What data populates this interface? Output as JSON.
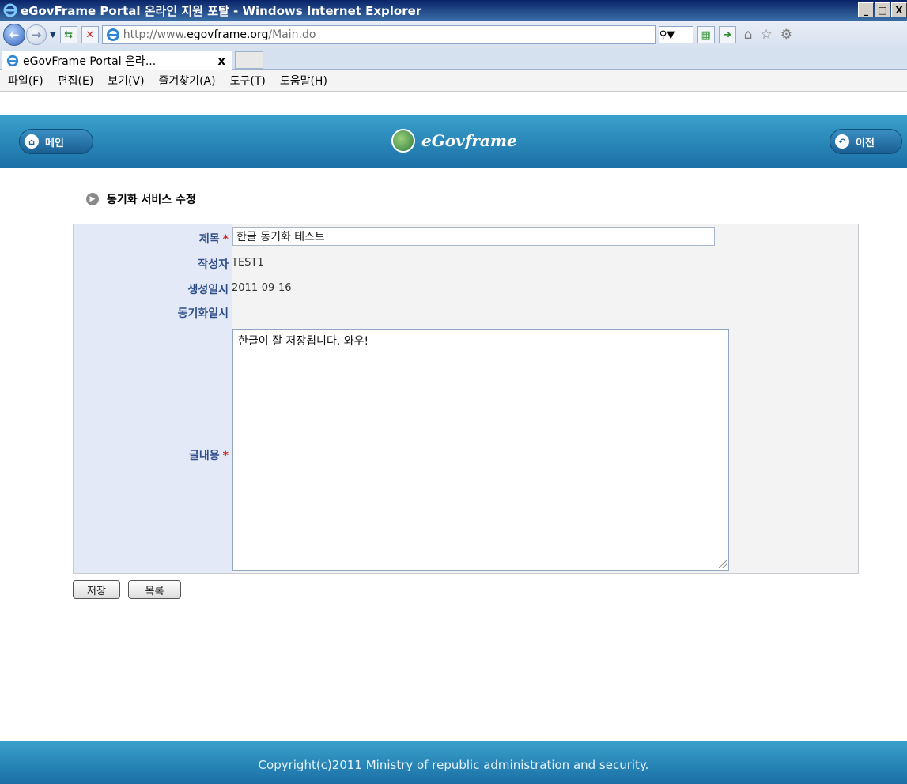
{
  "window": {
    "title": "eGovFrame Portal 온라인 지원 포탈 - Windows Internet Explorer",
    "min": "_",
    "max": "□",
    "close": "X"
  },
  "address": {
    "prefix": "http://www.",
    "host": "egovframe.org",
    "path": "/Main.do"
  },
  "tab": {
    "label": "eGovFrame Portal 온라...",
    "close": "x"
  },
  "menu": [
    "파일(F)",
    "편집(E)",
    "보기(V)",
    "즐겨찾기(A)",
    "도구(T)",
    "도움말(H)"
  ],
  "header": {
    "home_label": "메인",
    "brand": "eGovframe",
    "back_label": "이전"
  },
  "page": {
    "title": "동기화 서비스 수정"
  },
  "form": {
    "title_label": "제목",
    "title_value": "한글 동기화 테스트",
    "writer_label": "작성자",
    "writer_value": "TEST1",
    "created_label": "생성일시",
    "created_value": "2011-09-16",
    "synced_label": "동기화일시",
    "synced_value": "",
    "content_label": "글내용",
    "content_value": "한글이 잘 저장됩니다. 와우!",
    "required_mark": "*"
  },
  "actions": {
    "save": "저장",
    "list": "목록"
  },
  "footer": {
    "copyright": "Copyright(c)2011 Ministry of republic administration and security."
  },
  "icons": [
    "ie-logo-icon",
    "back-arrow-icon",
    "forward-arrow-icon",
    "refresh-icon",
    "stop-icon",
    "search-icon",
    "home-icon",
    "star-icon",
    "gear-icon",
    "globe-icon",
    "bullet-icon"
  ]
}
